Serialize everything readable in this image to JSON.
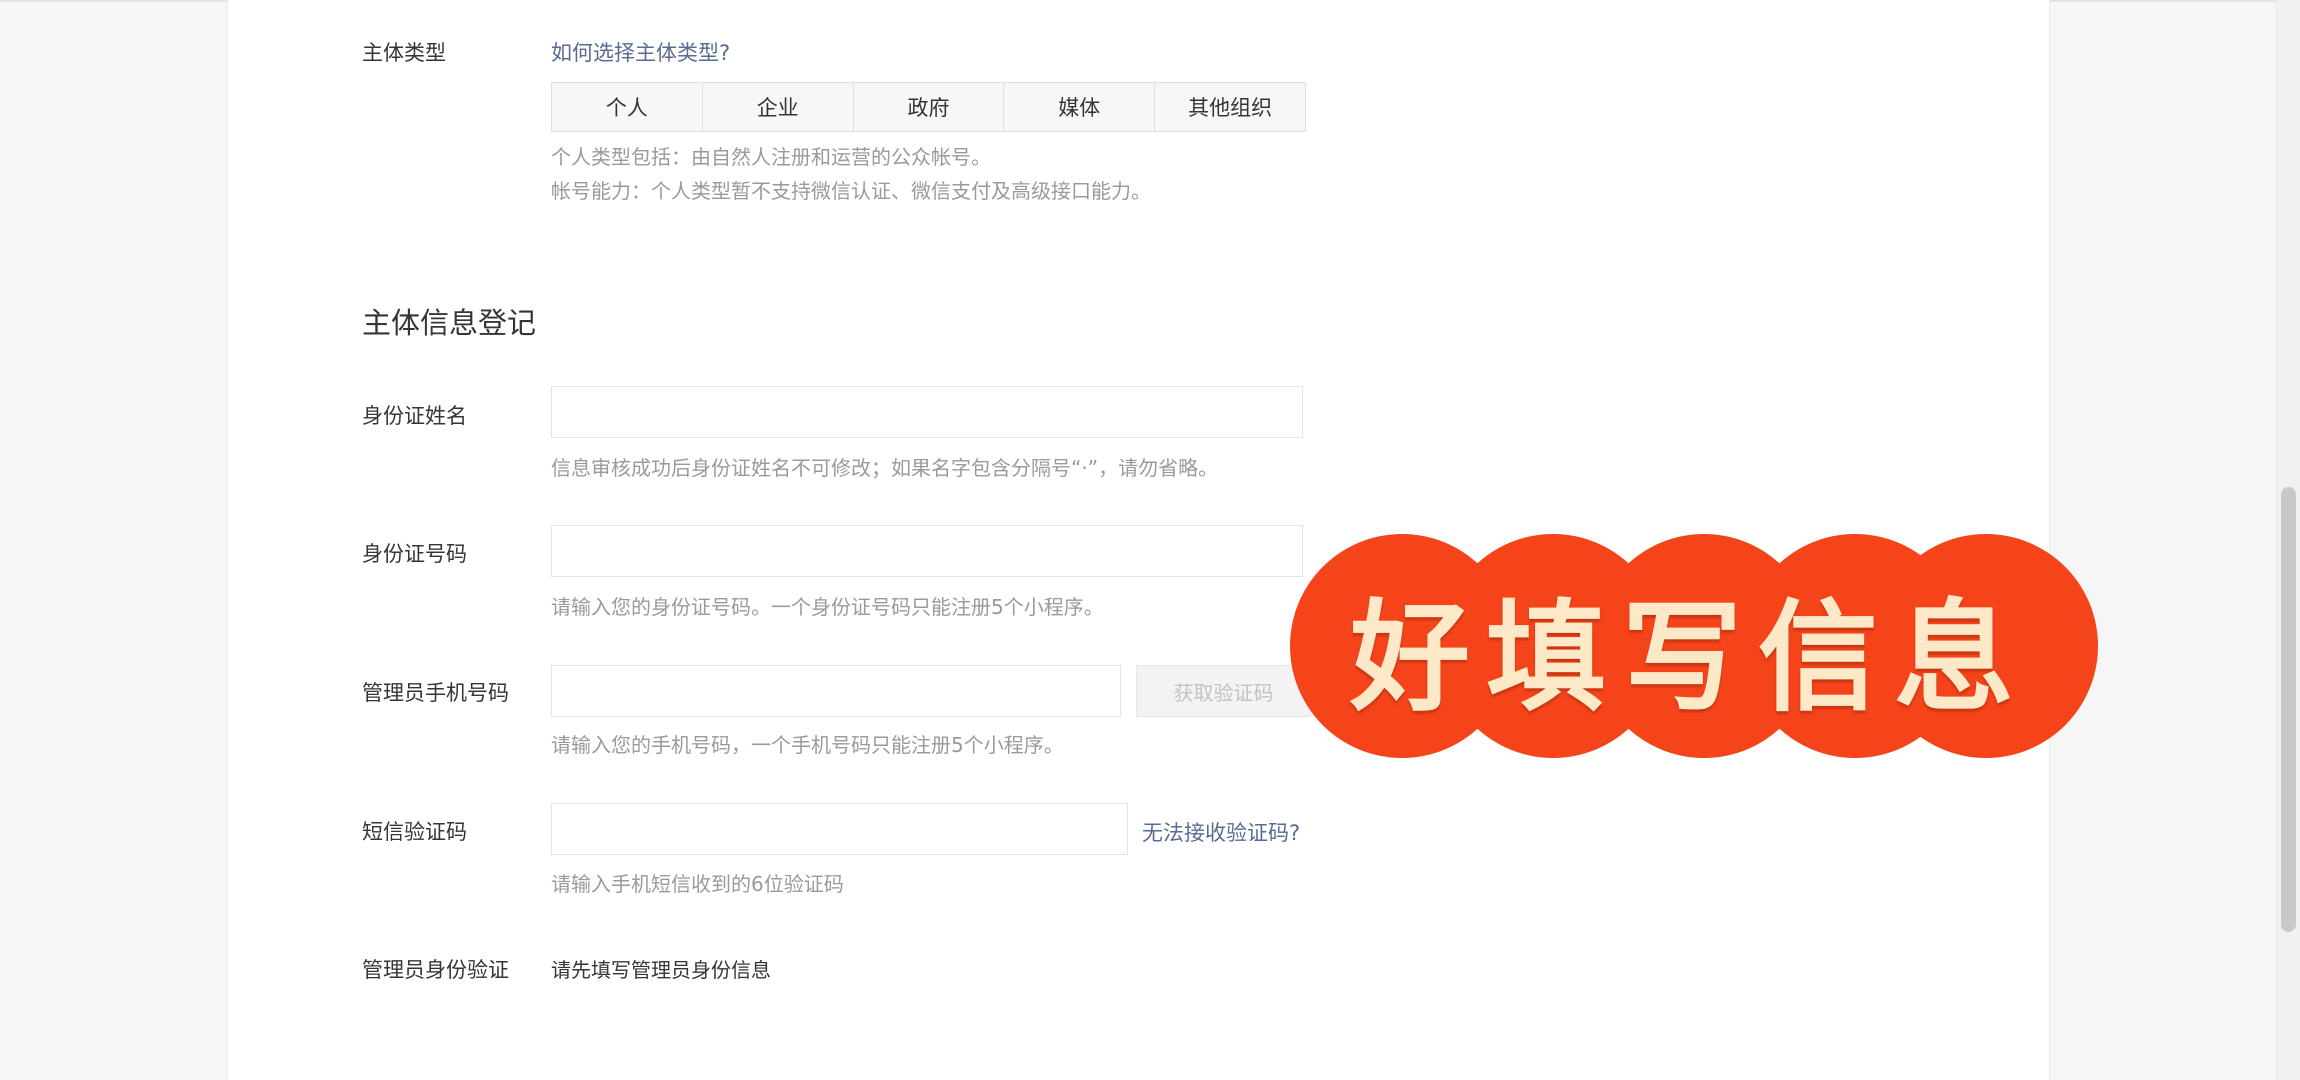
{
  "subject_type": {
    "label": "主体类型",
    "help_link": "如何选择主体类型?",
    "options": [
      "个人",
      "企业",
      "政府",
      "媒体",
      "其他组织"
    ],
    "tip_line1": "个人类型包括：由自然人注册和运营的公众帐号。",
    "tip_line2": "帐号能力：个人类型暂不支持微信认证、微信支付及高级接口能力。"
  },
  "section": {
    "title": "主体信息登记"
  },
  "id_name": {
    "label": "身份证姓名",
    "value": "",
    "tip": "信息审核成功后身份证姓名不可修改；如果名字包含分隔号“·”，请勿省略。"
  },
  "id_number": {
    "label": "身份证号码",
    "value": "",
    "tip": "请输入您的身份证号码。一个身份证号码只能注册5个小程序。"
  },
  "admin_phone": {
    "label": "管理员手机号码",
    "value": "",
    "button": "获取验证码",
    "tip": "请输入您的手机号码，一个手机号码只能注册5个小程序。"
  },
  "sms_code": {
    "label": "短信验证码",
    "value": "",
    "link": "无法接收验证码?",
    "tip": "请输入手机短信收到的6位验证码"
  },
  "admin_verify": {
    "label": "管理员身份验证",
    "text": "请先填写管理员身份信息"
  },
  "overlay": {
    "text": "好填写信息",
    "bg_color": "#f5441a",
    "text_color": "#fde8c8"
  },
  "scroll": {
    "position": 0.62
  }
}
